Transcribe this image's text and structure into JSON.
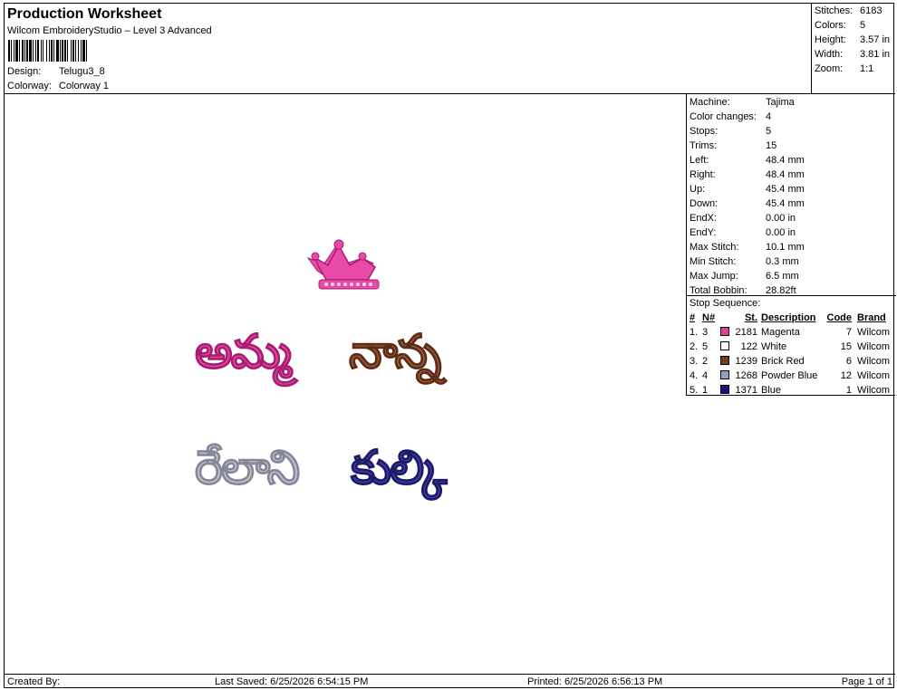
{
  "header": {
    "title": "Production Worksheet",
    "software": "Wilcom EmbroideryStudio – Level 3 Advanced",
    "design_label": "Design:",
    "design_value": "Telugu3_8",
    "colorway_label": "Colorway:",
    "colorway_value": "Colorway 1"
  },
  "stats": {
    "stitches_label": "Stitches:",
    "stitches_value": "6183",
    "colors_label": "Colors:",
    "colors_value": "5",
    "height_label": "Height:",
    "height_value": "3.57 in",
    "width_label": "Width:",
    "width_value": "3.81 in",
    "zoom_label": "Zoom:",
    "zoom_value": "1:1"
  },
  "machine": {
    "props": [
      {
        "label": "Machine:",
        "value": "Tajima"
      },
      {
        "label": "Color changes:",
        "value": "4"
      },
      {
        "label": "Stops:",
        "value": "5"
      },
      {
        "label": "Trims:",
        "value": "15"
      },
      {
        "label": "Left:",
        "value": "48.4 mm"
      },
      {
        "label": "Right:",
        "value": "48.4 mm"
      },
      {
        "label": "Up:",
        "value": "45.4 mm"
      },
      {
        "label": "Down:",
        "value": "45.4 mm"
      },
      {
        "label": "EndX:",
        "value": "0.00 in"
      },
      {
        "label": "EndY:",
        "value": "0.00 in"
      },
      {
        "label": "Max Stitch:",
        "value": "10.1 mm"
      },
      {
        "label": "Min Stitch:",
        "value": "0.3 mm"
      },
      {
        "label": "Max Jump:",
        "value": "6.5 mm"
      },
      {
        "label": "Total Bobbin:",
        "value": "28.82ft"
      }
    ]
  },
  "stop_sequence": {
    "title": "Stop Sequence:",
    "columns": {
      "num": "#",
      "n": "N#",
      "st": "St.",
      "desc": "Description",
      "code": "Code",
      "brand": "Brand"
    },
    "rows": [
      {
        "num": "1.",
        "n": "3",
        "color": "#e43f97",
        "st": "2181",
        "desc": "Magenta",
        "code": "7",
        "brand": "Wilcom"
      },
      {
        "num": "2.",
        "n": "5",
        "color": "#ffffff",
        "st": "122",
        "desc": "White",
        "code": "15",
        "brand": "Wilcom"
      },
      {
        "num": "3.",
        "n": "2",
        "color": "#7a3a1e",
        "st": "1239",
        "desc": "Brick Red",
        "code": "6",
        "brand": "Wilcom"
      },
      {
        "num": "4.",
        "n": "4",
        "color": "#9e9cc4",
        "st": "1268",
        "desc": "Powder Blue",
        "code": "12",
        "brand": "Wilcom"
      },
      {
        "num": "5.",
        "n": "1",
        "color": "#1a1680",
        "st": "1371",
        "desc": "Blue",
        "code": "1",
        "brand": "Wilcom"
      }
    ]
  },
  "design_text": {
    "word1": "అమ్మ",
    "word2": "నాన్న",
    "word3": "రేలాని",
    "word4": "కుల్కి"
  },
  "footer": {
    "created_by": "Created By:",
    "last_saved": "Last Saved: 6/25/2026 6:54:15 PM",
    "printed": "Printed: 6/25/2026 6:56:13 PM",
    "page": "Page 1 of 1"
  }
}
